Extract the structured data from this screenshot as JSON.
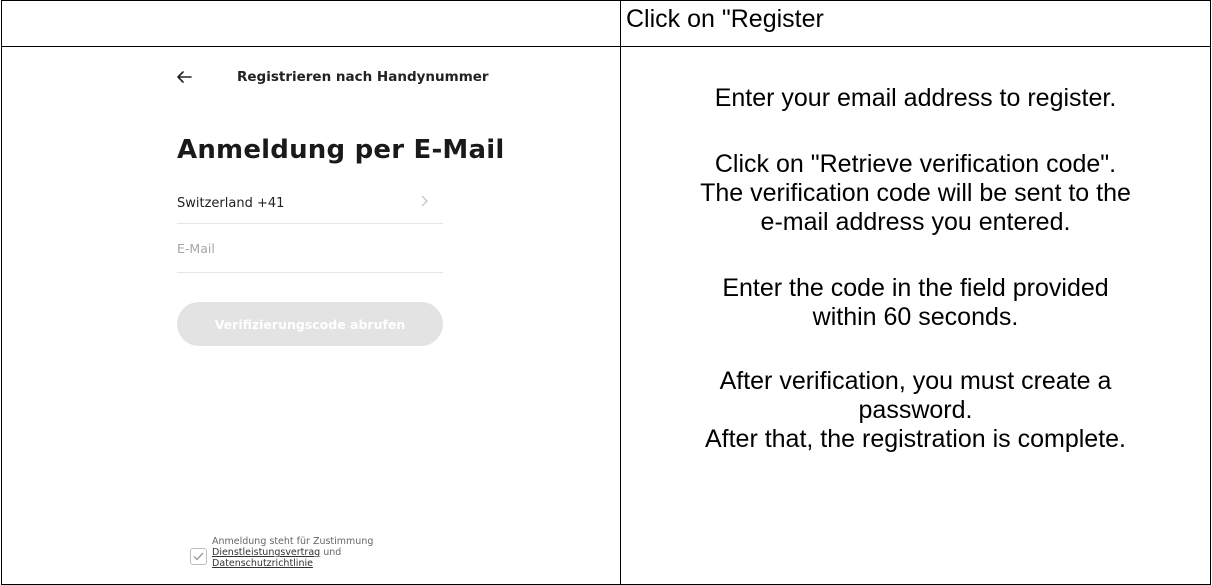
{
  "header": {
    "left_cell": "",
    "right_cell": "Click on \"Register"
  },
  "phone": {
    "nav_title": "Registrieren nach Handynummer",
    "page_title": "Anmeldung per E-Mail",
    "country_label": "Switzerland +41",
    "email_placeholder": "E-Mail",
    "email_value": "",
    "verify_button_label": "Verifizierungscode abrufen",
    "consent_line1": "Anmeldung steht für Zustimmung",
    "consent_link1": "Dienstleistungsvertrag",
    "consent_and": " und",
    "consent_link2": "Datenschutzrichtlinie",
    "checkbox_checked": true,
    "colors": {
      "button_disabled_bg": "#e3e3e3",
      "divider": "#e6e6e6",
      "placeholder": "#a6a6a6"
    },
    "icons": {
      "back": "back-arrow-icon",
      "chevron": "chevron-right-icon",
      "checkbox": "checkmark-icon"
    }
  },
  "instructions": {
    "line1": "Enter your email address to register.",
    "line2": "Click on \"Retrieve verification code\".",
    "line3": "The verification code will be sent to the",
    "line4": "e-mail address you entered.",
    "line5": "Enter the code in the field provided",
    "line6": "within 60 seconds.",
    "line7": "After verification, you must create a",
    "line8": "password.",
    "line9": "After that, the registration is complete."
  }
}
